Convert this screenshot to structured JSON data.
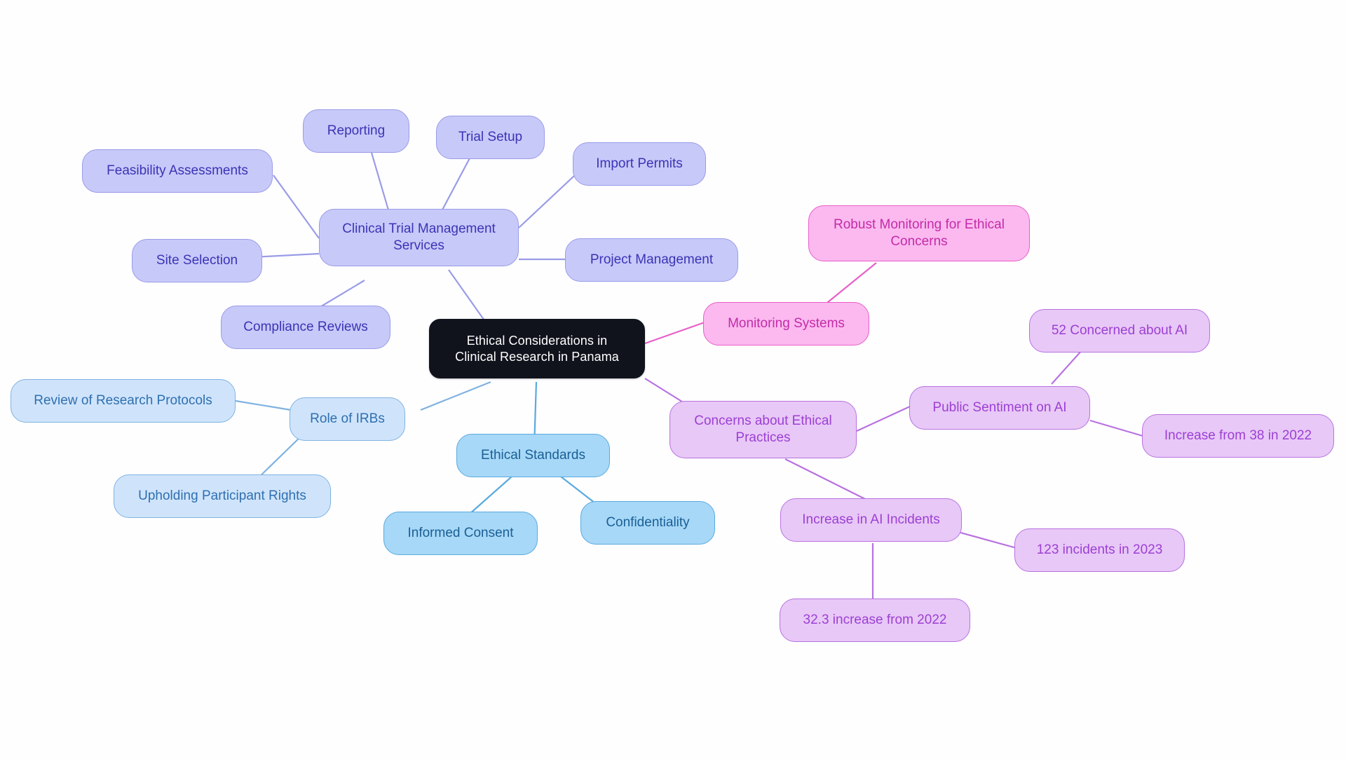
{
  "diagram": {
    "type": "mindmap",
    "title": "Ethical Considerations in Clinical Research in Panama",
    "background_color": "#fefeff"
  },
  "palette": {
    "root_fill": "#10131c",
    "root_text": "#ffffff",
    "periwinkle_fill": "#c7c9f9",
    "periwinkle_text": "#3a34b5",
    "periwinkle_line": "#9a9ce6",
    "paleblue_fill": "#cfe4fb",
    "paleblue_text": "#2f6fb0",
    "paleblue_line": "#7fb2e0",
    "skyblue_fill": "#a7d8f7",
    "skyblue_text": "#1a5f96",
    "skyblue_line": "#5aaade",
    "pink_fill": "#fbb9ef",
    "pink_text": "#c32ba8",
    "pink_line": "#e croppe",
    "pink_edge": "#e85fc8",
    "violet_fill": "#e8c8f6",
    "violet_text": "#9b3fd4",
    "violet_line": "#b872e0"
  },
  "nodes": {
    "root": {
      "label": "Ethical Considerations in\nClinical Research in Panama"
    },
    "ctms": {
      "label": "Clinical Trial Management\nServices"
    },
    "feasibility": {
      "label": "Feasibility Assessments"
    },
    "reporting": {
      "label": "Reporting"
    },
    "trial_setup": {
      "label": "Trial Setup"
    },
    "import_permits": {
      "label": "Import Permits"
    },
    "project_management": {
      "label": "Project Management"
    },
    "site_selection": {
      "label": "Site Selection"
    },
    "compliance_reviews": {
      "label": "Compliance Reviews"
    },
    "role_irbs": {
      "label": "Role of IRBs"
    },
    "review_protocols": {
      "label": "Review of Research Protocols"
    },
    "participant_rights": {
      "label": "Upholding Participant Rights"
    },
    "ethical_standards": {
      "label": "Ethical Standards"
    },
    "informed_consent": {
      "label": "Informed Consent"
    },
    "confidentiality": {
      "label": "Confidentiality"
    },
    "monitoring_systems": {
      "label": "Monitoring Systems"
    },
    "robust_monitoring": {
      "label": "Robust Monitoring for Ethical\nConcerns"
    },
    "concerns_ethical": {
      "label": "Concerns about Ethical\nPractices"
    },
    "public_sentiment": {
      "label": "Public Sentiment on AI"
    },
    "concerned_52": {
      "label": "52 Concerned about AI"
    },
    "increase_38": {
      "label": "Increase from 38 in 2022"
    },
    "increase_incidents": {
      "label": "Increase in AI Incidents"
    },
    "incidents_123": {
      "label": "123 incidents in 2023"
    },
    "increase_323": {
      "label": "32.3 increase from 2022"
    }
  },
  "chart_data": {
    "type": "mindmap",
    "title": "Ethical Considerations in Clinical Research in Panama",
    "root": "Ethical Considerations in Clinical Research in Panama",
    "branches": [
      {
        "name": "Clinical Trial Management Services",
        "color": "#c7c9f9",
        "children": [
          "Feasibility Assessments",
          "Reporting",
          "Trial Setup",
          "Import Permits",
          "Project Management",
          "Site Selection",
          "Compliance Reviews"
        ]
      },
      {
        "name": "Role of IRBs",
        "color": "#cfe4fb",
        "children": [
          "Review of Research Protocols",
          "Upholding Participant Rights"
        ]
      },
      {
        "name": "Ethical Standards",
        "color": "#a7d8f7",
        "children": [
          "Informed Consent",
          "Confidentiality"
        ]
      },
      {
        "name": "Monitoring Systems",
        "color": "#fbb9ef",
        "children": [
          "Robust Monitoring for Ethical Concerns"
        ]
      },
      {
        "name": "Concerns about Ethical Practices",
        "color": "#e8c8f6",
        "children": [
          {
            "name": "Public Sentiment on AI",
            "children": [
              "52 Concerned about AI",
              "Increase from 38 in 2022"
            ]
          },
          {
            "name": "Increase in AI Incidents",
            "children": [
              "123 incidents in 2023",
              "32.3 increase from 2022"
            ]
          }
        ]
      }
    ]
  }
}
